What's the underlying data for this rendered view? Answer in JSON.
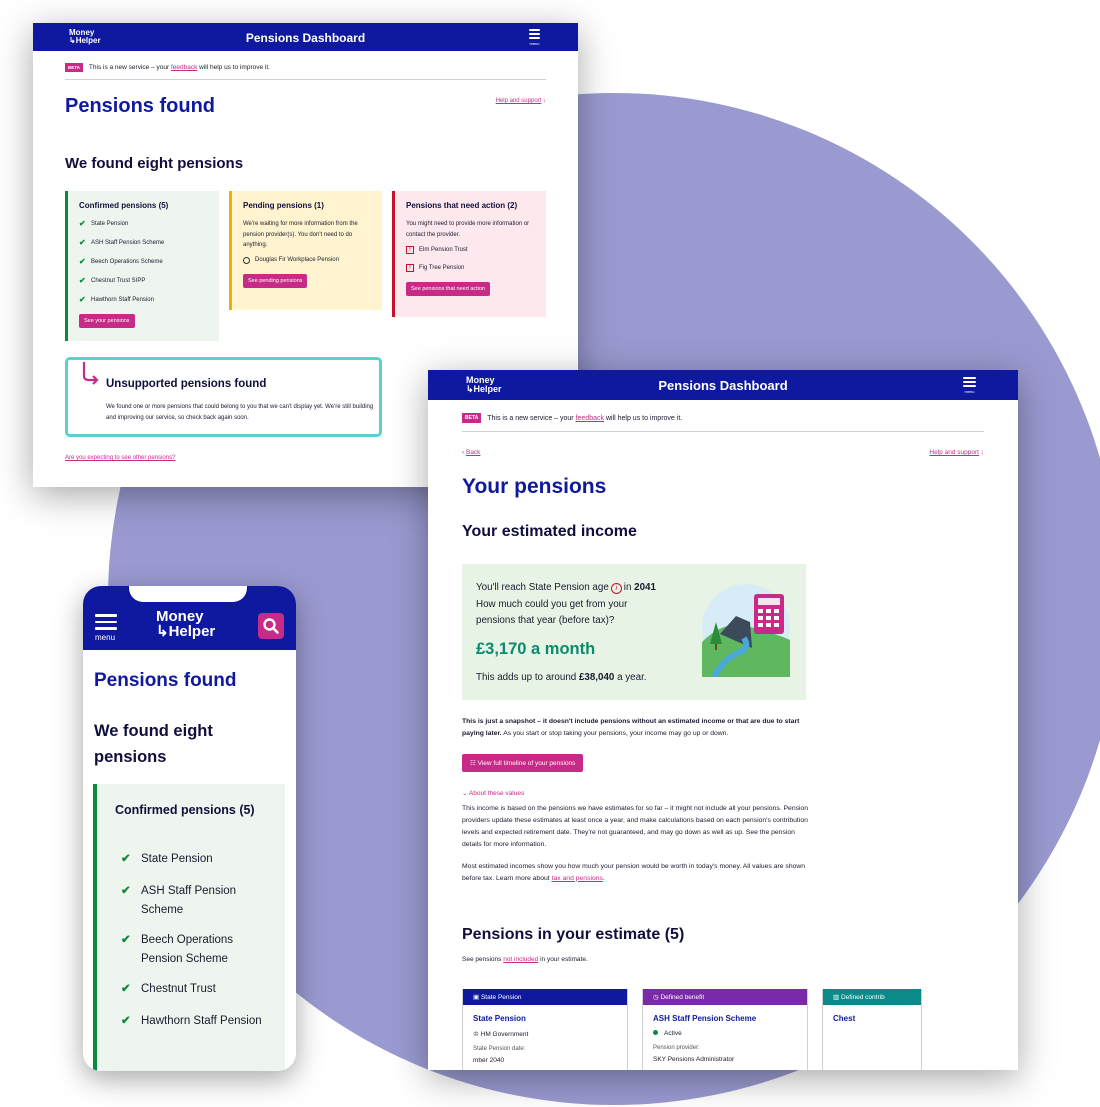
{
  "brand": {
    "logo_line1": "Money",
    "logo_line2": "Helper",
    "accent": "#c82a87",
    "navy": "#0f19a0"
  },
  "desktop1": {
    "header_title": "Pensions Dashboard",
    "menu_label": "menu",
    "beta_label": "BETA",
    "beta_text_before": "This is a new service – your",
    "beta_link": "feedback",
    "beta_text_after": "will help us to improve it.",
    "page_title": "Pensions found",
    "help_link": "Help and support",
    "subtitle": "We found eight pensions",
    "confirmed": {
      "title": "Confirmed pensions (5)",
      "items": [
        "State Pension",
        "ASH Staff Pension Scheme",
        "Beech Operations Scheme",
        "Chestnut Trust SIPP",
        "Hawthorn Staff Pension"
      ],
      "button": "See your pensions"
    },
    "pending": {
      "title": "Pending pensions (1)",
      "text": "We're waiting for more information from the pension provider(s). You don't need to do anything.",
      "item": "Douglas Fir Workplace Pension",
      "button": "See pending pensions"
    },
    "action": {
      "title": "Pensions that need action (2)",
      "text": "You might need to provide more information or contact the provider.",
      "items": [
        "Elm Pension Trust",
        "Fig Tree Pension"
      ],
      "button": "See pensions that need action"
    },
    "unsupported": {
      "title": "Unsupported pensions found",
      "text": "We found one or more pensions that could belong to you that we can't display yet. We're still building and improving our service, so check back again soon."
    },
    "other_link": "Are you expecting to see other pensions?"
  },
  "desktop2": {
    "header_title": "Pensions Dashboard",
    "menu_label": "menu",
    "beta_label": "BETA",
    "beta_text_before": "This is a new service – your",
    "beta_link": "feedback",
    "beta_text_after": "will help us to improve it.",
    "back_link": "Back",
    "help_link": "Help and support",
    "page_title": "Your pensions",
    "income_heading": "Your estimated income",
    "estimate": {
      "line1_before": "You'll reach State Pension age",
      "line1_year_prefix": "in",
      "year": "2041",
      "line2": "How much could you get from your",
      "line3": "pensions that year (before tax)?",
      "amount": "£3,170 a month",
      "year_before": "This adds up to around",
      "year_amount": "£38,040",
      "year_after": "a year."
    },
    "snapshot_bold": "This is just a snapshot – it doesn't include pensions without an estimated income or that are due to start paying later.",
    "snapshot_text": "As you start or stop taking your pensions, your income may go up or down.",
    "timeline_button": "View full timeline of your pensions",
    "about_link": "About these values",
    "about_text": "This income is based on the pensions we have estimates for so far – it might not include all your pensions. Pension providers update these estimates at least once a year, and make calculations based on each pension's contribution levels and expected retirement date. They're not guaranteed, and may go down as well as up. See the pension details for more information.",
    "about_text2_before": "Most estimated incomes show you how much your pension would be worth in today's money. All values are shown before tax. Learn more about",
    "about_text2_link": "tax and pensions",
    "estimate_heading": "Pensions in your estimate (5)",
    "see_before": "See pensions",
    "see_link": "not included",
    "see_after": "in your estimate.",
    "cards": [
      {
        "type": "State Pension",
        "name": "State Pension",
        "line": "HM Government",
        "key": "State Pension date:",
        "value": "mber 2040"
      },
      {
        "type": "Defined benefit",
        "name": "ASH Staff Pension Scheme",
        "line": "Active",
        "key": "Pension provider:",
        "value": "SKY Pensions Administrator"
      },
      {
        "type": "Defined contrib",
        "name": "Chest"
      }
    ]
  },
  "phone": {
    "menu_label": "menu",
    "page_title": "Pensions found",
    "subtitle": "We found eight pensions",
    "confirmed_title": "Confirmed pensions (5)",
    "items": [
      "State Pension",
      "ASH Staff Pension Scheme",
      "Beech Operations Pension Scheme",
      "Chestnut Trust",
      "Hawthorn Staff Pension"
    ]
  }
}
